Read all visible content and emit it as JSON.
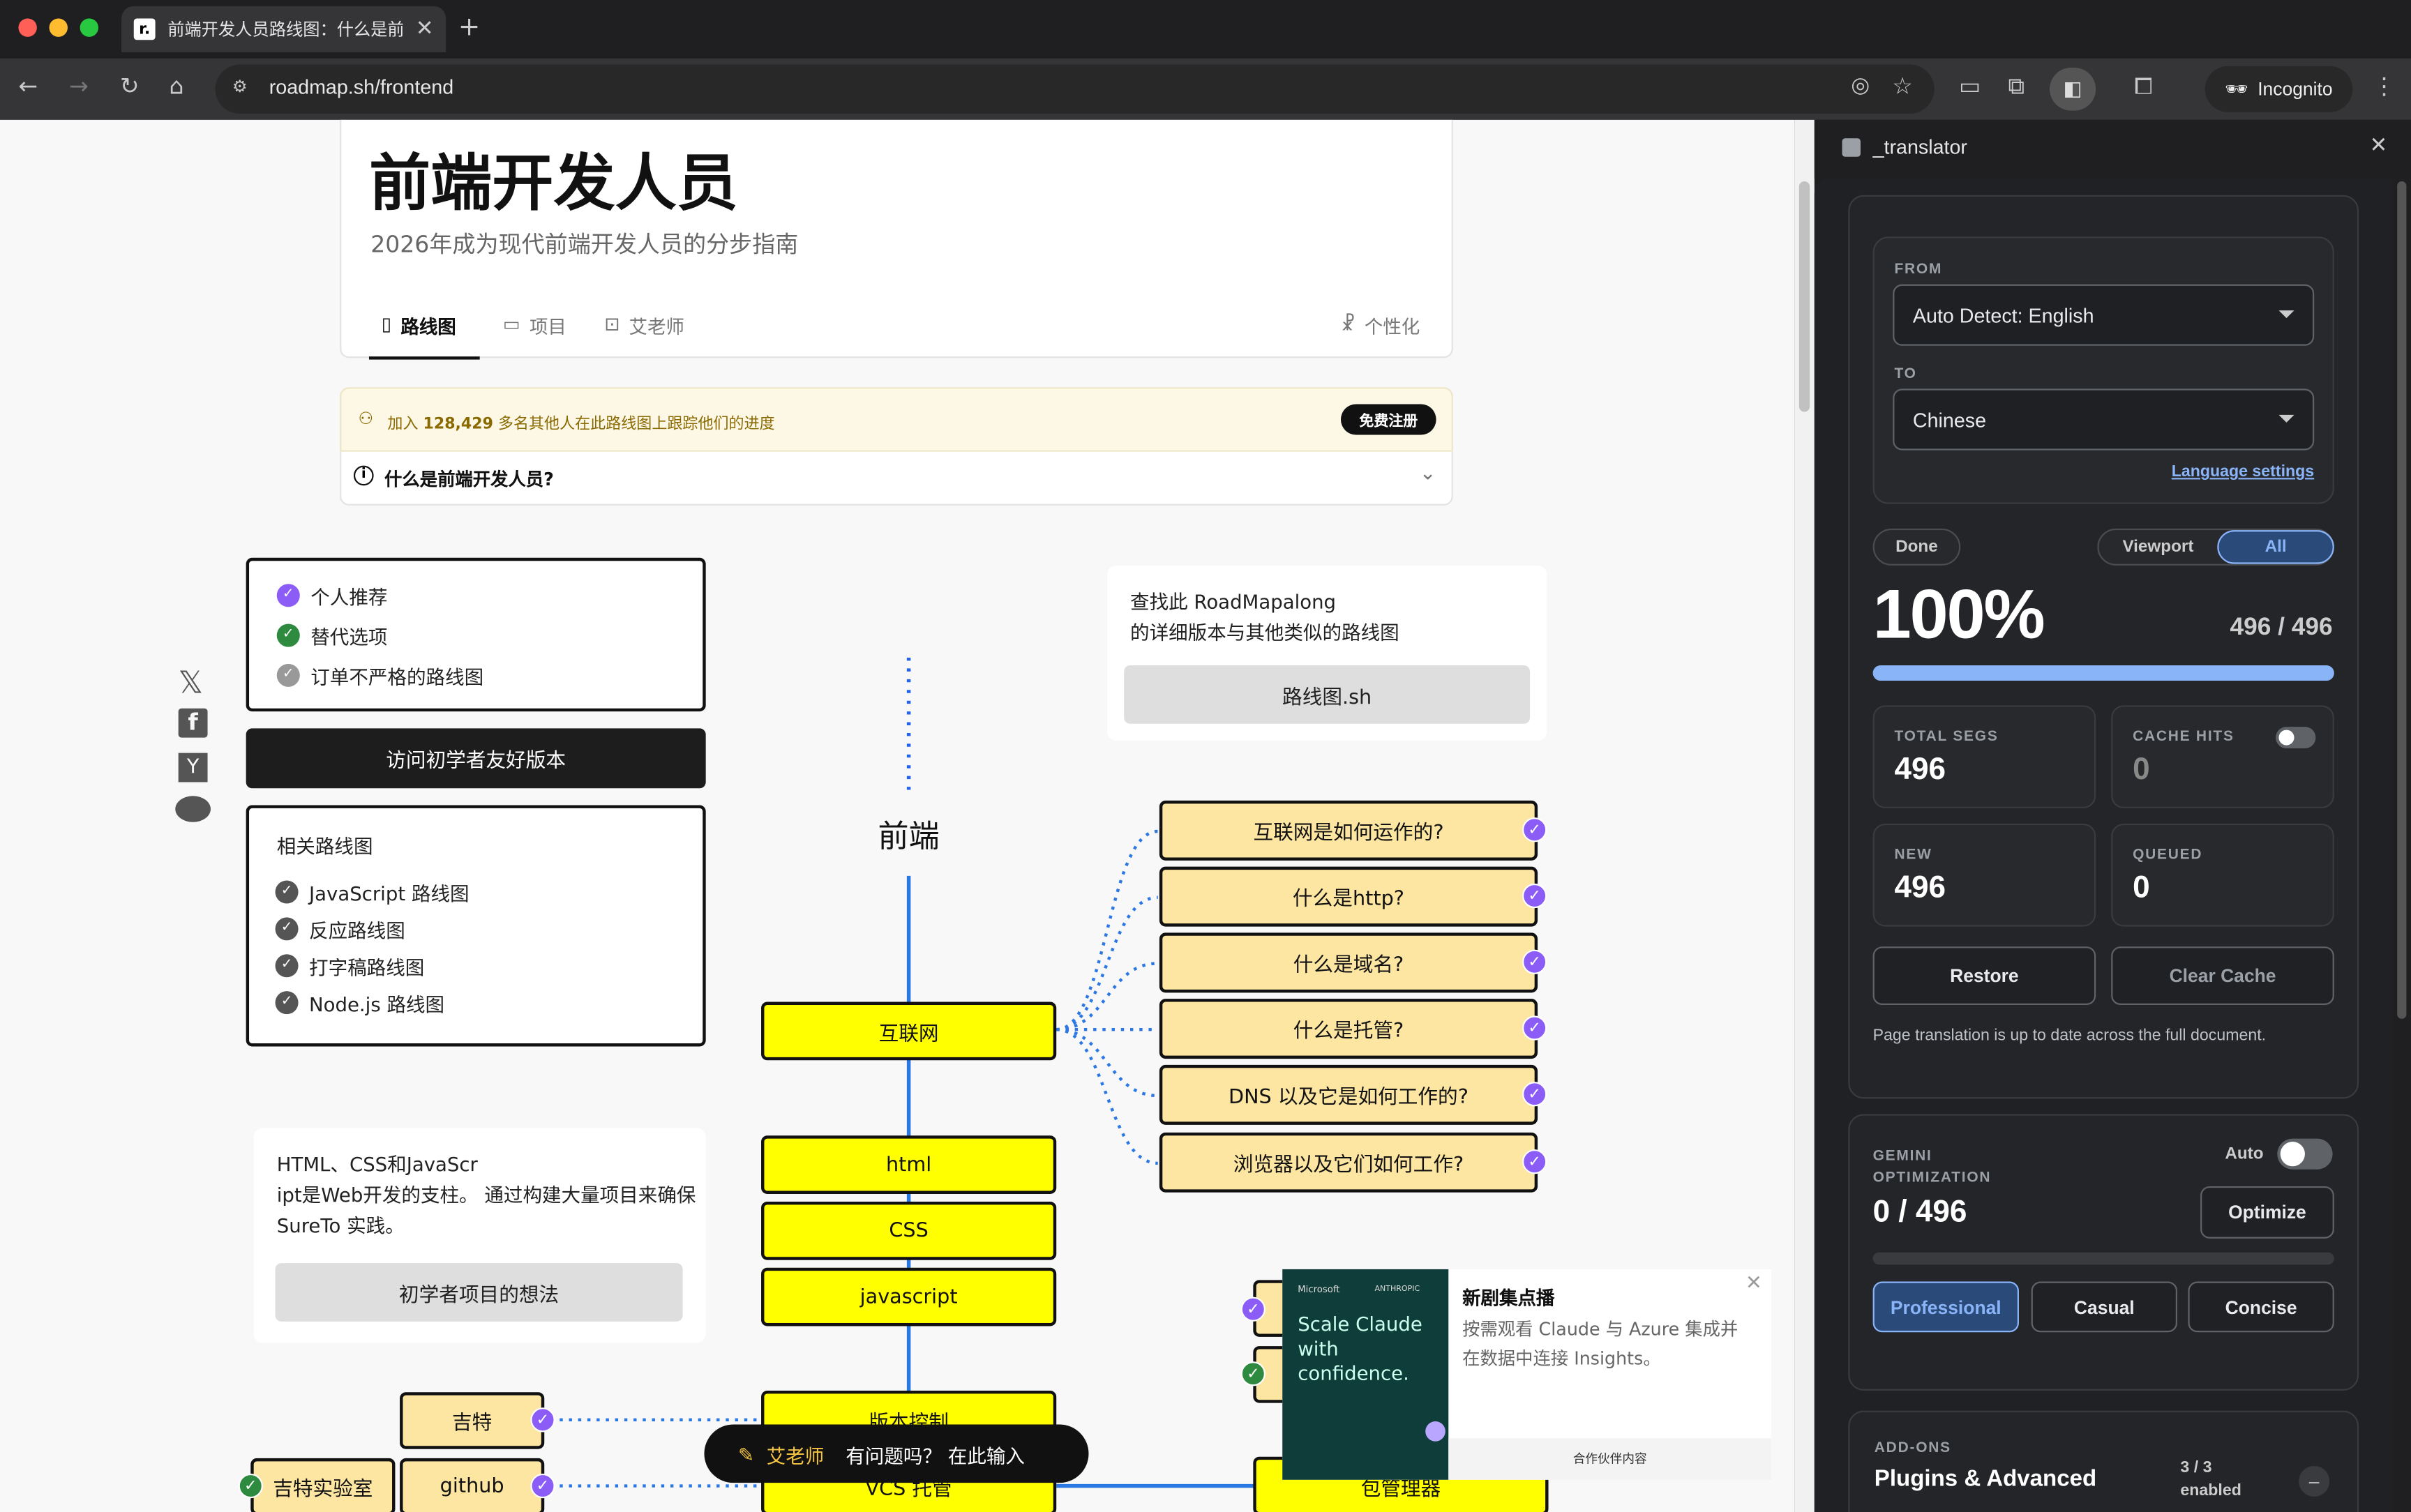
{
  "browser": {
    "tab_title": "前端开发人员路线图：什么是前",
    "url": "roadmap.sh/frontend",
    "incognito_label": "Incognito",
    "favicon_text": "r."
  },
  "page": {
    "title": "前端开发人员",
    "subtitle": "2026年成为现代前端开发人员的分步指南",
    "tabs": [
      "路线图",
      "项目",
      "艾老师"
    ],
    "personalize": "个性化",
    "banner_text_pre": "加入 ",
    "banner_count": "128,429",
    "banner_text_post": " 多名其他人在此路线图上跟踪他们的进度",
    "signup_button": "免费注册",
    "faq_question": "什么是前端开发人员?",
    "legend_items": [
      "个人推荐",
      "替代选项",
      "订单不严格的路线图"
    ],
    "beginner_button": "访问初学者友好版本",
    "related_title": "相关路线图",
    "related_items": [
      "JavaScript 路线图",
      "反应路线图",
      "打字稿路线图",
      "Node.js 路线图"
    ],
    "find_text_1": "查找此 RoadMapalong",
    "find_text_2": "的详细版本与其他类似的路线图",
    "find_button": "路线图.sh",
    "projects_text_1": "HTML、CSS和JavaScr",
    "projects_text_2": "ipt是Web开发的支柱。 通过构建大量项目来确保",
    "projects_text_3": "SureTo 实践。",
    "projects_button": "初学者项目的想法",
    "root_label": "前端",
    "main_nodes": [
      "互联网",
      "html",
      "CSS",
      "javascript",
      "版本控制",
      "VCS 托管",
      "包管理器"
    ],
    "internet_topics": [
      "互联网是如何运作的?",
      "什么是http?",
      "什么是域名?",
      "什么是托管?",
      "DNS 以及它是如何工作的?",
      "浏览器以及它们如何工作?"
    ],
    "vcs_items": [
      "吉特",
      "吉特实验室",
      "github"
    ],
    "ai_chip_label": "艾老师",
    "ai_chip_text": "有问题吗？ 在此输入",
    "ad": {
      "brand_1": "Microsoft",
      "brand_2": "ANTHROPIC",
      "tagline": "Scale Claude with confidence.",
      "title": "新剧集点播",
      "body": "按需观看 Claude 与 Azure 集成并在数据中连接 Insights。",
      "footer": "合作伙伴内容"
    },
    "social_icons": [
      "x-icon",
      "facebook-icon",
      "hackernews-icon",
      "reddit-icon"
    ]
  },
  "translator": {
    "panel_title": "_translator",
    "from_label": "FROM",
    "from_value": "Auto Detect: English",
    "to_label": "TO",
    "to_value": "Chinese",
    "language_settings": "Language settings",
    "done_label": "Done",
    "scope_options": [
      "Viewport",
      "All"
    ],
    "scope_selected": "All",
    "percent": "100%",
    "progress_count": "496 / 496",
    "progress_fraction": 1.0,
    "total_segs_label": "TOTAL SEGS",
    "total_segs": "496",
    "cache_hits_label": "CACHE HITS",
    "cache_hits": "0",
    "new_label": "NEW",
    "new_value": "496",
    "queued_label": "QUEUED",
    "queued_value": "0",
    "restore_button": "Restore",
    "clear_cache_button": "Clear Cache",
    "status_text": "Page translation is up to date across the full document.",
    "gemini_label_1": "GEMINI",
    "gemini_label_2": "OPTIMIZATION",
    "auto_label": "Auto",
    "optimize_count": "0 / 496",
    "optimize_button": "Optimize",
    "styles": [
      "Professional",
      "Casual",
      "Concise"
    ],
    "style_selected": "Professional",
    "addons_label": "ADD-ONS",
    "addons_title": "Plugins & Advanced",
    "addons_count": "3 / 3",
    "addons_enabled": "enabled"
  },
  "colors": {
    "accent": "#8ab4f8",
    "node_yellow": "#ffff00",
    "topic_orange": "#fde5a2",
    "check_purple": "#8b5cf6",
    "check_green": "#2d8a3e"
  }
}
